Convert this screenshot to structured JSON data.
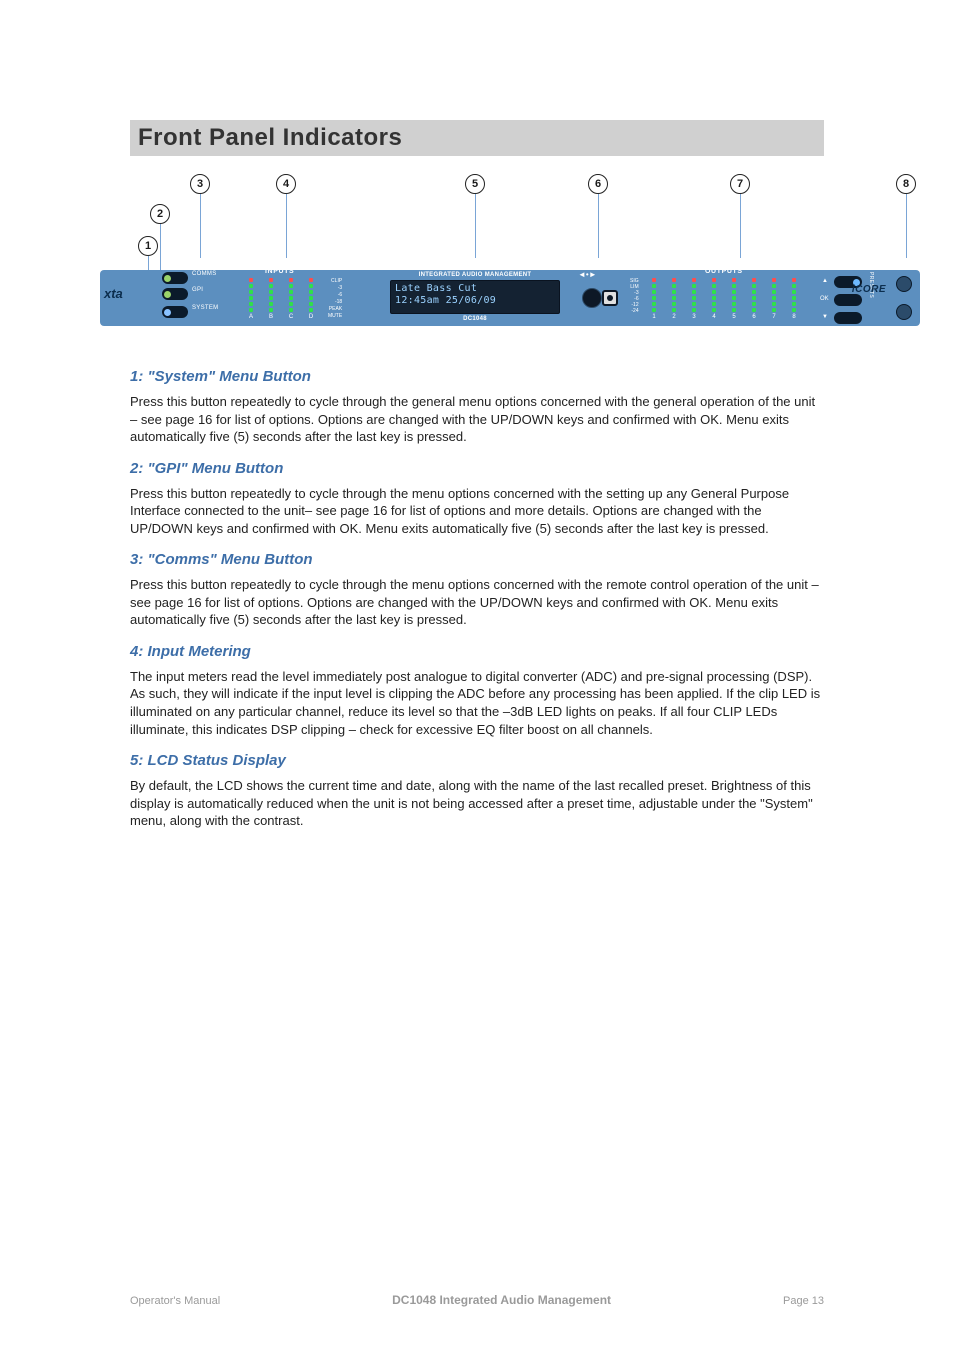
{
  "section_title": "Front Panel Indicators",
  "diagram": {
    "callouts": [
      "1",
      "2",
      "3",
      "4",
      "5",
      "6",
      "7",
      "8"
    ],
    "brand": "xta",
    "side_buttons": [
      {
        "label": "COMMS"
      },
      {
        "label": "GPI"
      },
      {
        "label": "SYSTEM"
      }
    ],
    "inputs_label": "INPUTS",
    "input_channels": [
      "A",
      "B",
      "C",
      "D"
    ],
    "scale_in": [
      "CLIP",
      "-3",
      "-6",
      "-18",
      "PEAK",
      "MUTE"
    ],
    "lcd_header": "INTEGRATED AUDIO MANAGEMENT",
    "lcd_line1": "Late Bass Cut",
    "lcd_line2": "12:45am 25/06/09",
    "model": "DC1048",
    "headphone_icon": "◄•►",
    "scale_out": [
      "SIG",
      "LIM",
      "-3",
      "-6",
      "-12",
      "-24"
    ],
    "outputs_label": "OUTPUTS",
    "output_channels": [
      "1",
      "2",
      "3",
      "4",
      "5",
      "6",
      "7",
      "8"
    ],
    "nav": {
      "up": "▲",
      "ok": "OK",
      "down": "▼"
    },
    "presets": "PRESETS",
    "icore": "iCORE"
  },
  "sections": [
    {
      "heading": "1:  \"System\" Menu Button",
      "body": "Press this button repeatedly to cycle through the general menu options concerned with the general operation of the unit – see page 16 for list of options.  Options are changed with the UP/DOWN keys and confirmed with OK.  Menu exits automatically five (5) seconds after the last key is pressed."
    },
    {
      "heading": "2:  \"GPI\" Menu Button",
      "body": "Press this button repeatedly to cycle through the menu options concerned with the setting up any General Purpose Interface connected to the unit– see page 16 for list of options and more details.  Options are changed with the UP/DOWN keys and confirmed with OK.  Menu exits automatically five (5) seconds after the last key is pressed."
    },
    {
      "heading": "3:  \"Comms\" Menu Button",
      "body": "Press this button repeatedly to cycle through the menu options concerned with the remote control operation of the unit – see page 16 for list of options.  Options are changed with the UP/DOWN keys and confirmed with OK.  Menu exits automatically five (5) seconds after the last key is pressed."
    },
    {
      "heading": "4:  Input Metering",
      "body": "The input meters read the level immediately post analogue to digital converter (ADC) and pre-signal processing (DSP).  As such, they will indicate if the input level is clipping the ADC before any processing has been applied.  If the clip LED is illuminated on any particular channel, reduce its level so that the –3dB LED lights on peaks.  If all four CLIP LEDs illuminate, this indicates DSP clipping – check for excessive EQ filter boost on all channels."
    },
    {
      "heading": "5:  LCD Status Display",
      "body": "By default, the LCD shows the current time and date, along with the name of the last recalled preset.  Brightness of this display is automatically reduced when the unit is not being accessed after a preset time, adjustable under the \"System\" menu, along with the contrast."
    }
  ],
  "footer": {
    "left": "Operator's Manual",
    "mid": "DC1048 Integrated Audio Management",
    "right": "Page 13"
  }
}
